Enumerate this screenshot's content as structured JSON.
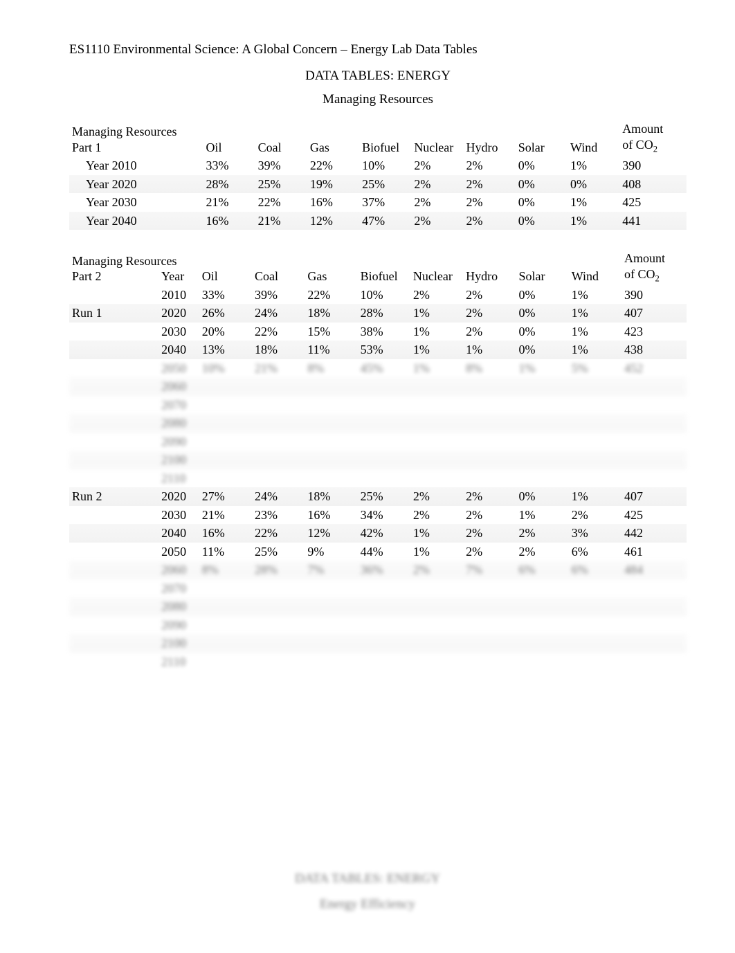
{
  "doc_title": "ES1110 Environmental Science: A Global Concern – Energy Lab Data Tables",
  "section_title": "DATA TABLES: ENERGY",
  "subtitle": "Managing Resources",
  "co2_label_line1": "Amount",
  "co2_label_line2_prefix": "of CO",
  "co2_label_sub": "2",
  "table1": {
    "header_label_line1": "Managing Resources",
    "header_label_line2": "Part 1",
    "columns": [
      "Oil",
      "Coal",
      "Gas",
      "Biofuel",
      "Nuclear",
      "Hydro",
      "Solar",
      "Wind"
    ],
    "rows": [
      {
        "label": "Year 2010",
        "cells": [
          "33%",
          "39%",
          "22%",
          "10%",
          "2%",
          "2%",
          "0%",
          "1%",
          "390"
        ]
      },
      {
        "label": "Year 2020",
        "cells": [
          "28%",
          "25%",
          "19%",
          "25%",
          "2%",
          "2%",
          "0%",
          "0%",
          "408"
        ]
      },
      {
        "label": "Year 2030",
        "cells": [
          "21%",
          "22%",
          "16%",
          "37%",
          "2%",
          "2%",
          "0%",
          "1%",
          "425"
        ]
      },
      {
        "label": "Year 2040",
        "cells": [
          "16%",
          "21%",
          "12%",
          "47%",
          "2%",
          "2%",
          "0%",
          "1%",
          "441"
        ]
      }
    ]
  },
  "table2": {
    "header_label_line1": "Managing Resources",
    "header_label_line2": "Part 2",
    "year_col": "Year",
    "columns": [
      "Oil",
      "Coal",
      "Gas",
      "Biofuel",
      "Nuclear",
      "Hydro",
      "Solar",
      "Wind"
    ],
    "groups": [
      {
        "run": "Run 1",
        "rows": [
          {
            "year": "2010",
            "cells": [
              "33%",
              "39%",
              "22%",
              "10%",
              "2%",
              "2%",
              "0%",
              "1%",
              "390"
            ]
          },
          {
            "year": "2020",
            "cells": [
              "26%",
              "24%",
              "18%",
              "28%",
              "1%",
              "2%",
              "0%",
              "1%",
              "407"
            ]
          },
          {
            "year": "2030",
            "cells": [
              "20%",
              "22%",
              "15%",
              "38%",
              "1%",
              "2%",
              "0%",
              "1%",
              "423"
            ]
          },
          {
            "year": "2040",
            "cells": [
              "13%",
              "18%",
              "11%",
              "53%",
              "1%",
              "1%",
              "0%",
              "1%",
              "438"
            ]
          },
          {
            "year": "2050",
            "cells": [
              "10%",
              "21%",
              "8%",
              "45%",
              "1%",
              "8%",
              "1%",
              "5%",
              "452"
            ],
            "blur": true
          },
          {
            "year": "2060",
            "cells": [
              "",
              "",
              "",
              "",
              "",
              "",
              "",
              "",
              ""
            ],
            "blur": true
          },
          {
            "year": "2070",
            "cells": [
              "",
              "",
              "",
              "",
              "",
              "",
              "",
              "",
              ""
            ],
            "blur": true
          },
          {
            "year": "2080",
            "cells": [
              "",
              "",
              "",
              "",
              "",
              "",
              "",
              "",
              ""
            ],
            "blur": true
          },
          {
            "year": "2090",
            "cells": [
              "",
              "",
              "",
              "",
              "",
              "",
              "",
              "",
              ""
            ],
            "blur": true
          },
          {
            "year": "2100",
            "cells": [
              "",
              "",
              "",
              "",
              "",
              "",
              "",
              "",
              ""
            ],
            "blur": true
          },
          {
            "year": "2110",
            "cells": [
              "",
              "",
              "",
              "",
              "",
              "",
              "",
              "",
              ""
            ],
            "blur": true
          }
        ]
      },
      {
        "run": "Run 2",
        "rows": [
          {
            "year": "2020",
            "cells": [
              "27%",
              "24%",
              "18%",
              "25%",
              "2%",
              "2%",
              "0%",
              "1%",
              "407"
            ]
          },
          {
            "year": "2030",
            "cells": [
              "21%",
              "23%",
              "16%",
              "34%",
              "2%",
              "2%",
              "1%",
              "2%",
              "425"
            ]
          },
          {
            "year": "2040",
            "cells": [
              "16%",
              "22%",
              "12%",
              "42%",
              "1%",
              "2%",
              "2%",
              "3%",
              "442"
            ]
          },
          {
            "year": "2050",
            "cells": [
              "11%",
              "25%",
              "9%",
              "44%",
              "1%",
              "2%",
              "2%",
              "6%",
              "461"
            ]
          },
          {
            "year": "2060",
            "cells": [
              "8%",
              "28%",
              "7%",
              "36%",
              "2%",
              "7%",
              "6%",
              "6%",
              "484"
            ],
            "blur": true
          },
          {
            "year": "2070",
            "cells": [
              "",
              "",
              "",
              "",
              "",
              "",
              "",
              "",
              ""
            ],
            "blur": true
          },
          {
            "year": "2080",
            "cells": [
              "",
              "",
              "",
              "",
              "",
              "",
              "",
              "",
              ""
            ],
            "blur": true
          },
          {
            "year": "2090",
            "cells": [
              "",
              "",
              "",
              "",
              "",
              "",
              "",
              "",
              ""
            ],
            "blur": true
          },
          {
            "year": "2100",
            "cells": [
              "",
              "",
              "",
              "",
              "",
              "",
              "",
              "",
              ""
            ],
            "blur": true
          },
          {
            "year": "2110",
            "cells": [
              "",
              "",
              "",
              "",
              "",
              "",
              "",
              "",
              ""
            ],
            "blur": true
          }
        ]
      }
    ]
  },
  "footer": {
    "section_title": "DATA TABLES: ENERGY",
    "subtitle": "Energy Efficiency"
  },
  "chart_data": [
    {
      "type": "table",
      "title": "Managing Resources Part 1",
      "columns": [
        "Year",
        "Oil",
        "Coal",
        "Gas",
        "Biofuel",
        "Nuclear",
        "Hydro",
        "Solar",
        "Wind",
        "Amount of CO2"
      ],
      "rows": [
        [
          "2010",
          "33%",
          "39%",
          "22%",
          "10%",
          "2%",
          "2%",
          "0%",
          "1%",
          390
        ],
        [
          "2020",
          "28%",
          "25%",
          "19%",
          "25%",
          "2%",
          "2%",
          "0%",
          "0%",
          408
        ],
        [
          "2030",
          "21%",
          "22%",
          "16%",
          "37%",
          "2%",
          "2%",
          "0%",
          "1%",
          425
        ],
        [
          "2040",
          "16%",
          "21%",
          "12%",
          "47%",
          "2%",
          "2%",
          "0%",
          "1%",
          441
        ]
      ]
    },
    {
      "type": "table",
      "title": "Managing Resources Part 2 – Run 1",
      "columns": [
        "Year",
        "Oil",
        "Coal",
        "Gas",
        "Biofuel",
        "Nuclear",
        "Hydro",
        "Solar",
        "Wind",
        "Amount of CO2"
      ],
      "rows": [
        [
          "2010",
          "33%",
          "39%",
          "22%",
          "10%",
          "2%",
          "2%",
          "0%",
          "1%",
          390
        ],
        [
          "2020",
          "26%",
          "24%",
          "18%",
          "28%",
          "1%",
          "2%",
          "0%",
          "1%",
          407
        ],
        [
          "2030",
          "20%",
          "22%",
          "15%",
          "38%",
          "1%",
          "2%",
          "0%",
          "1%",
          423
        ],
        [
          "2040",
          "13%",
          "18%",
          "11%",
          "53%",
          "1%",
          "1%",
          "0%",
          "1%",
          438
        ],
        [
          "2050",
          "10%",
          "21%",
          "8%",
          "45%",
          "1%",
          "8%",
          "1%",
          "5%",
          452
        ]
      ]
    },
    {
      "type": "table",
      "title": "Managing Resources Part 2 – Run 2",
      "columns": [
        "Year",
        "Oil",
        "Coal",
        "Gas",
        "Biofuel",
        "Nuclear",
        "Hydro",
        "Solar",
        "Wind",
        "Amount of CO2"
      ],
      "rows": [
        [
          "2020",
          "27%",
          "24%",
          "18%",
          "25%",
          "2%",
          "2%",
          "0%",
          "1%",
          407
        ],
        [
          "2030",
          "21%",
          "23%",
          "16%",
          "34%",
          "2%",
          "2%",
          "1%",
          "2%",
          425
        ],
        [
          "2040",
          "16%",
          "22%",
          "12%",
          "42%",
          "1%",
          "2%",
          "2%",
          "3%",
          442
        ],
        [
          "2050",
          "11%",
          "25%",
          "9%",
          "44%",
          "1%",
          "2%",
          "2%",
          "6%",
          461
        ],
        [
          "2060",
          "8%",
          "28%",
          "7%",
          "36%",
          "2%",
          "7%",
          "6%",
          "6%",
          484
        ]
      ]
    }
  ]
}
